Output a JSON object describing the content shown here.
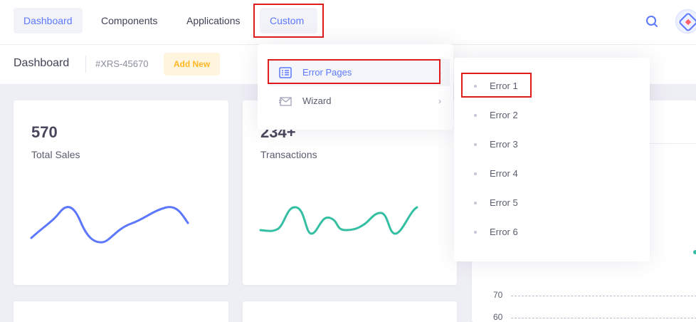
{
  "nav": {
    "items": [
      {
        "label": "Dashboard"
      },
      {
        "label": "Components"
      },
      {
        "label": "Applications"
      },
      {
        "label": "Custom"
      }
    ]
  },
  "subheader": {
    "title": "Dashboard",
    "code": "#XRS-45670",
    "add_label": "Add New"
  },
  "cards": [
    {
      "value": "570",
      "label": "Total Sales"
    },
    {
      "value": "234+",
      "label": "Transactions"
    }
  ],
  "chart_axis": {
    "ticks": [
      "70",
      "60"
    ]
  },
  "custom_menu": {
    "items": [
      {
        "label": "Error Pages",
        "icon": "list-icon",
        "arrow": "›"
      },
      {
        "label": "Wizard",
        "icon": "mail-icon",
        "arrow": "›"
      }
    ]
  },
  "error_submenu": {
    "items": [
      {
        "label": "Error 1"
      },
      {
        "label": "Error 2"
      },
      {
        "label": "Error 3"
      },
      {
        "label": "Error 4"
      },
      {
        "label": "Error 5"
      },
      {
        "label": "Error 6"
      }
    ]
  },
  "colors": {
    "accent": "#5d78ff",
    "success": "#34bfa3",
    "warning": "#ffb822",
    "highlight": "#e01b1b"
  }
}
